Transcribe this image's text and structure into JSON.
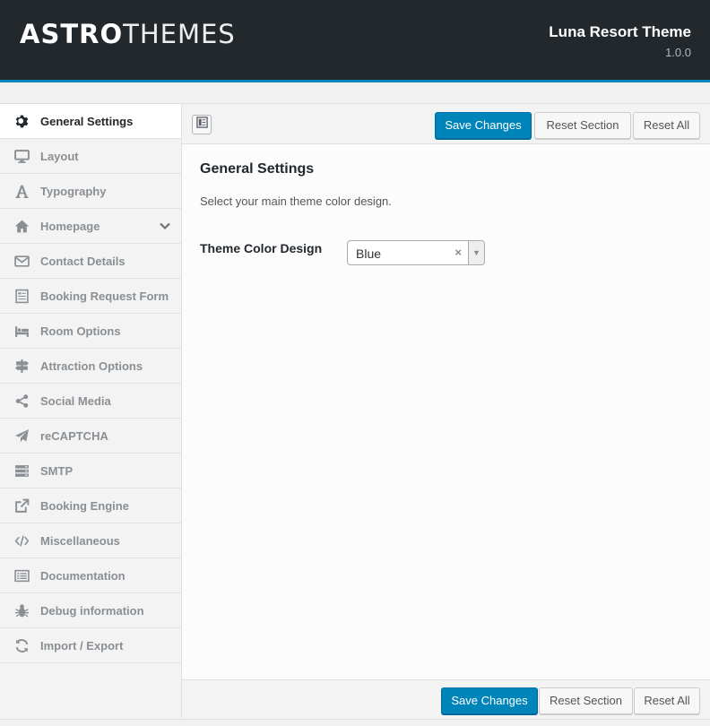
{
  "header": {
    "logo_bold": "ASTRO",
    "logo_light": "THEMES",
    "theme_name": "Luna Resort Theme",
    "version": "1.0.0",
    "accent_color": "#0085ba"
  },
  "sidebar": {
    "items": [
      {
        "label": "General Settings",
        "icon": "gear-icon",
        "active": true
      },
      {
        "label": "Layout",
        "icon": "monitor-icon"
      },
      {
        "label": "Typography",
        "icon": "font-icon"
      },
      {
        "label": "Homepage",
        "icon": "home-icon",
        "has_submenu": true
      },
      {
        "label": "Contact Details",
        "icon": "envelope-icon"
      },
      {
        "label": "Booking Request Form",
        "icon": "form-icon"
      },
      {
        "label": "Room Options",
        "icon": "bed-icon"
      },
      {
        "label": "Attraction Options",
        "icon": "signpost-icon"
      },
      {
        "label": "Social Media",
        "icon": "share-icon"
      },
      {
        "label": "reCAPTCHA",
        "icon": "paper-plane-icon"
      },
      {
        "label": "SMTP",
        "icon": "server-icon"
      },
      {
        "label": "Booking Engine",
        "icon": "external-link-icon"
      },
      {
        "label": "Miscellaneous",
        "icon": "code-icon"
      },
      {
        "label": "Documentation",
        "icon": "list-icon"
      },
      {
        "label": "Debug information",
        "icon": "bug-icon"
      },
      {
        "label": "Import / Export",
        "icon": "refresh-icon"
      }
    ]
  },
  "toolbar": {
    "save_label": "Save Changes",
    "reset_section_label": "Reset Section",
    "reset_all_label": "Reset All"
  },
  "section": {
    "title": "General Settings",
    "description": "Select your main theme color design.",
    "field_label": "Theme Color Design",
    "field_value": "Blue",
    "clear_glyph": "×",
    "arrow_glyph": "▼"
  },
  "footer": {
    "save_label": "Save Changes",
    "reset_section_label": "Reset Section",
    "reset_all_label": "Reset All"
  }
}
